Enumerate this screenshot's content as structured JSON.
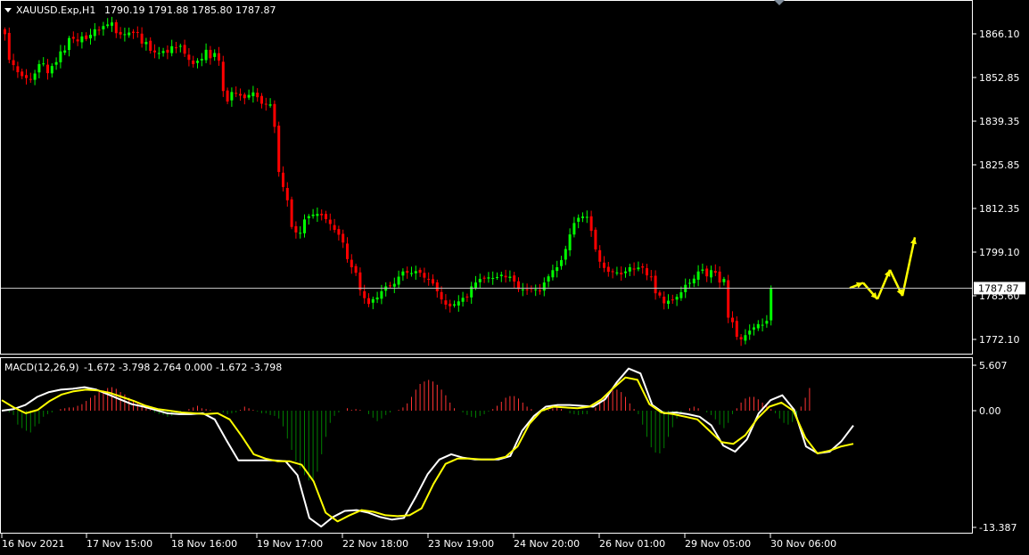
{
  "chart_data": [
    {
      "type": "candlestick",
      "title": "XAUUSD.Exp,H1",
      "ohlc_header": "1790.19 1791.88 1785.80 1787.87",
      "y_ticks": [
        "1866.10",
        "1852.85",
        "1839.35",
        "1825.85",
        "1812.35",
        "1799.10",
        "1785.60",
        "1772.10"
      ],
      "ylim": [
        1765.0,
        1874.0
      ],
      "current_price": 1787.87,
      "current_price_label": "1787.87",
      "colors": {
        "bull": "#00ff00",
        "bear": "#ff0000",
        "price_line": "#c0c0c0",
        "forecast": "#ffff00"
      },
      "candles_close": [
        1866.0,
        1858.1,
        1856.5,
        1854.3,
        1853.1,
        1852.5,
        1852.2,
        1853.9,
        1856.8,
        1857.0,
        1854.0,
        1856.2,
        1857.4,
        1860.7,
        1861.0,
        1864.8,
        1864.6,
        1863.8,
        1865.3,
        1864.5,
        1865.8,
        1867.5,
        1867.1,
        1868.5,
        1869.0,
        1869.6,
        1866.3,
        1865.9,
        1866.0,
        1866.5,
        1866.4,
        1866.5,
        1863.1,
        1863.6,
        1860.9,
        1860.4,
        1860.2,
        1860.8,
        1860.3,
        1862.3,
        1861.9,
        1862.4,
        1860.0,
        1858.1,
        1856.8,
        1857.8,
        1858.4,
        1861.2,
        1858.6,
        1860.2,
        1857.9,
        1848.5,
        1845.3,
        1848.2,
        1847.9,
        1847.1,
        1846.3,
        1847.3,
        1848.1,
        1846.6,
        1844.6,
        1844.4,
        1844.4,
        1837.5,
        1823.6,
        1819.0,
        1814.9,
        1806.7,
        1805.0,
        1804.9,
        1809.0,
        1810.0,
        1810.5,
        1810.7,
        1810.3,
        1809.1,
        1807.6,
        1805.8,
        1804.3,
        1801.9,
        1796.8,
        1794.3,
        1792.6,
        1787.3,
        1784.8,
        1783.0,
        1784.5,
        1785.0,
        1786.9,
        1788.4,
        1788.6,
        1789.2,
        1791.4,
        1793.0,
        1792.6,
        1792.5,
        1793.1,
        1792.6,
        1791.1,
        1790.5,
        1789.3,
        1786.9,
        1784.4,
        1782.8,
        1782.3,
        1782.9,
        1783.8,
        1784.9,
        1785.0,
        1788.4,
        1789.6,
        1790.7,
        1791.0,
        1791.2,
        1791.0,
        1791.3,
        1792.0,
        1791.2,
        1791.4,
        1789.9,
        1787.6,
        1787.5,
        1787.5,
        1787.6,
        1787.5,
        1786.9,
        1789.6,
        1791.5,
        1793.4,
        1794.3,
        1796.5,
        1799.9,
        1804.4,
        1807.9,
        1809.5,
        1809.9,
        1809.8,
        1805.5,
        1799.8,
        1796.0,
        1794.1,
        1792.9,
        1792.8,
        1792.7,
        1792.1,
        1793.0,
        1794.3,
        1793.6,
        1794.2,
        1794.2,
        1791.8,
        1791.4,
        1786.3,
        1785.6,
        1783.2,
        1784.0,
        1784.3,
        1785.2,
        1786.6,
        1788.9,
        1789.5,
        1790.8,
        1793.0,
        1793.6,
        1791.5,
        1793.4,
        1792.6,
        1789.6,
        1790.7,
        1778.8,
        1777.4,
        1772.9,
        1772.1,
        1773.4,
        1774.8,
        1775.8,
        1776.8,
        1776.6,
        1777.8,
        1787.9
      ],
      "forecast_price": [
        1787.9,
        1789.5,
        1784.5,
        1793.5,
        1785.5,
        1803.5
      ],
      "series": []
    },
    {
      "type": "macd",
      "title": "MACD(12,26,9)",
      "header_values": "-1.672 -3.798 2.764 0.000 -1.672 -3.798",
      "y_ticks": [
        "5.607",
        "0.00",
        "-13.387"
      ],
      "ylim": [
        -13.387,
        5.607
      ],
      "colors": {
        "histogram_positive": "#ff3333",
        "histogram_negative": "#008000",
        "macd": "#ffffff",
        "signal": "#ffff00"
      },
      "series": [
        {
          "values": [
            0.0,
            0.2,
            0.7,
            1.7,
            2.3,
            2.6,
            2.7,
            2.9,
            2.6,
            2.0,
            1.4,
            0.8,
            0.5,
            0.1,
            -0.3,
            -0.4,
            -0.4,
            -0.3,
            -1.0,
            -3.4,
            -5.7,
            -5.7,
            -5.7,
            -5.7,
            -5.8,
            -7.4,
            -12.3,
            -13.3,
            -12.2,
            -11.5,
            -11.4,
            -11.7,
            -12.2,
            -12.5,
            -12.3,
            -9.9,
            -7.3,
            -5.6,
            -5.0,
            -5.4,
            -5.6,
            -5.6,
            -5.6,
            -5.2,
            -2.3,
            -0.6,
            0.5,
            0.7,
            0.7,
            0.6,
            0.5,
            1.4,
            3.5,
            5.2,
            4.6,
            0.7,
            -0.3,
            -0.2,
            -0.4,
            -0.7,
            -1.7,
            -4.0,
            -4.7,
            -3.3,
            -0.3,
            1.3,
            1.9,
            0.1,
            -4.1,
            -4.9,
            -4.7,
            -3.5,
            -1.7
          ]
        },
        {
          "values": [
            1.3,
            0.4,
            -0.3,
            0.1,
            1.2,
            2.0,
            2.4,
            2.6,
            2.5,
            2.2,
            1.7,
            1.2,
            0.6,
            0.2,
            0.0,
            -0.2,
            -0.3,
            -0.4,
            -0.3,
            -1.0,
            -2.9,
            -5.0,
            -5.5,
            -5.8,
            -5.8,
            -6.2,
            -8.1,
            -11.7,
            -12.7,
            -12.0,
            -11.4,
            -11.6,
            -12.0,
            -12.1,
            -12.0,
            -11.2,
            -8.4,
            -6.1,
            -5.5,
            -5.5,
            -5.6,
            -5.6,
            -5.3,
            -4.1,
            -1.5,
            0.0,
            0.5,
            0.4,
            0.3,
            0.5,
            1.4,
            2.8,
            4.1,
            3.8,
            0.8,
            -0.2,
            -0.4,
            -0.7,
            -1.0,
            -2.3,
            -3.6,
            -3.8,
            -2.8,
            -0.9,
            0.5,
            1.0,
            0.0,
            -3.1,
            -4.9,
            -4.6,
            -4.1,
            -3.8
          ]
        }
      ],
      "histogram": [
        0.0,
        -0.2,
        -0.5,
        -1.6,
        -2.0,
        -2.3,
        -2.5,
        -1.8,
        -1.5,
        -0.7,
        -0.4,
        -0.2,
        0.0,
        0.2,
        0.3,
        0.4,
        0.4,
        0.6,
        0.8,
        1.2,
        1.6,
        1.9,
        2.3,
        2.5,
        2.8,
        2.9,
        2.7,
        2.3,
        2.0,
        1.6,
        1.2,
        0.9,
        0.6,
        0.4,
        0.1,
        -0.2,
        -0.4,
        -0.5,
        -0.7,
        -0.6,
        -0.3,
        -0.2,
        0.0,
        0.2,
        0.4,
        0.6,
        0.3,
        0.2,
        0.1,
        0.0,
        0.0,
        -0.2,
        -0.4,
        -0.3,
        -0.2,
        0.1,
        0.5,
        0.3,
        0.1,
        -0.1,
        -0.3,
        -0.3,
        -0.5,
        -0.6,
        -0.9,
        -1.8,
        -3.2,
        -4.5,
        -5.8,
        -6.6,
        -7.4,
        -8.0,
        -8.2,
        -7.0,
        -5.0,
        -3.0,
        -1.4,
        -0.6,
        -0.2,
        0.0,
        0.3,
        0.1,
        0.2,
        0.1,
        0.0,
        -0.4,
        -0.8,
        -1.2,
        -0.9,
        -0.5,
        -0.2,
        0.0,
        0.1,
        0.4,
        0.9,
        1.7,
        2.6,
        3.3,
        3.6,
        3.8,
        3.6,
        3.2,
        2.6,
        1.9,
        1.0,
        0.3,
        0.0,
        -0.2,
        -0.5,
        -0.7,
        -0.8,
        -0.6,
        -0.4,
        -0.1,
        0.2,
        0.6,
        1.1,
        1.6,
        1.8,
        1.8,
        1.5,
        1.0,
        0.5,
        0.2,
        0.0,
        -0.1,
        -0.1,
        0.1,
        0.3,
        0.4,
        0.2,
        0.0,
        -0.3,
        -0.4,
        -0.5,
        -0.4,
        -0.4,
        0.0,
        0.4,
        1.0,
        1.6,
        2.2,
        2.5,
        2.6,
        2.3,
        1.7,
        0.9,
        0.2,
        -0.4,
        -1.6,
        -3.0,
        -4.2,
        -4.8,
        -4.9,
        -4.3,
        -3.0,
        -1.9,
        -0.9,
        -0.3,
        0.0,
        0.3,
        0.5,
        0.3,
        0.0,
        -0.2,
        -0.5,
        -1.0,
        -1.6,
        -2.0,
        -1.4,
        -0.4,
        0.3,
        1.0,
        1.5,
        1.7,
        1.7,
        1.4,
        1.0,
        0.6,
        0.2,
        -0.3,
        -0.9,
        -1.4,
        -1.6,
        -1.3,
        -0.6,
        0.5,
        1.6,
        2.8
      ]
    }
  ],
  "x_axis_labels": [
    "16 Nov 2021",
    "17 Nov 15:00",
    "18 Nov 16:00",
    "19 Nov 17:00",
    "22 Nov 18:00",
    "23 Nov 19:00",
    "24 Nov 20:00",
    "26 Nov 01:00",
    "29 Nov 05:00",
    "30 Nov 06:00"
  ]
}
